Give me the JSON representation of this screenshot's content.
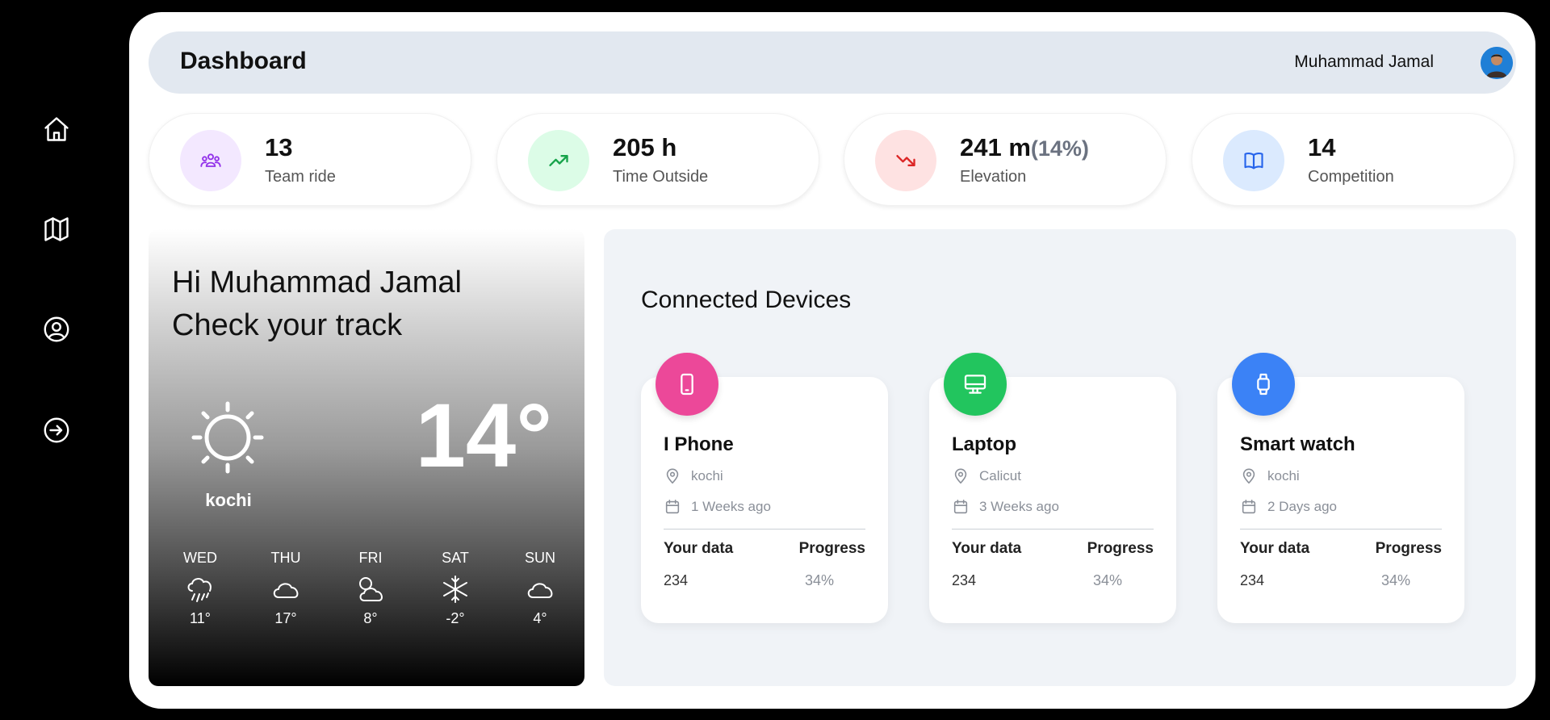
{
  "sidebar": {
    "icons": [
      "home-icon",
      "map-icon",
      "user-circle-icon",
      "logout-icon"
    ]
  },
  "header": {
    "title": "Dashboard",
    "user_name": "Muhammad Jamal"
  },
  "stats": [
    {
      "value": "13",
      "suffix": "",
      "label": "Team ride",
      "icon": "team-icon",
      "bg": "#f3e8ff",
      "color": "#9333ea"
    },
    {
      "value": "205 h",
      "suffix": "",
      "label": "Time Outside",
      "icon": "trending-up-icon",
      "bg": "#dcfce7",
      "color": "#16a34a"
    },
    {
      "value": "241 m",
      "suffix": "(14%)",
      "label": "Elevation",
      "icon": "trending-down-icon",
      "bg": "#fee2e2",
      "color": "#dc2626"
    },
    {
      "value": "14",
      "suffix": "",
      "label": "Competition",
      "icon": "book-icon",
      "bg": "#dbeafe",
      "color": "#2563eb"
    }
  ],
  "weather": {
    "greeting_line1": "Hi Muhammad Jamal",
    "greeting_line2": "Check your track",
    "city": "kochi",
    "temperature": "14°",
    "forecast": [
      {
        "day": "WED",
        "icon": "rain-cloud-icon",
        "temp": "11°"
      },
      {
        "day": "THU",
        "icon": "cloud-icon",
        "temp": "17°"
      },
      {
        "day": "FRI",
        "icon": "sun-cloud-icon",
        "temp": "8°"
      },
      {
        "day": "SAT",
        "icon": "snowflake-icon",
        "temp": "-2°"
      },
      {
        "day": "SUN",
        "icon": "cloud-icon",
        "temp": "4°"
      }
    ]
  },
  "devices": {
    "title": "Connected Devices",
    "items": [
      {
        "name": "I Phone",
        "location": "kochi",
        "time": "1 Weeks ago",
        "data_label": "Your data",
        "progress_label": "Progress",
        "data_value": "234",
        "progress_value": "34%",
        "icon": "phone-icon",
        "color": "#ec4899"
      },
      {
        "name": "Laptop",
        "location": "Calicut",
        "time": "3 Weeks ago",
        "data_label": "Your data",
        "progress_label": "Progress",
        "data_value": "234",
        "progress_value": "34%",
        "icon": "laptop-icon",
        "color": "#22c55e"
      },
      {
        "name": "Smart watch",
        "location": "kochi",
        "time": "2 Days ago",
        "data_label": "Your data",
        "progress_label": "Progress",
        "data_value": "234",
        "progress_value": "34%",
        "icon": "watch-icon",
        "color": "#3b82f6"
      }
    ]
  }
}
